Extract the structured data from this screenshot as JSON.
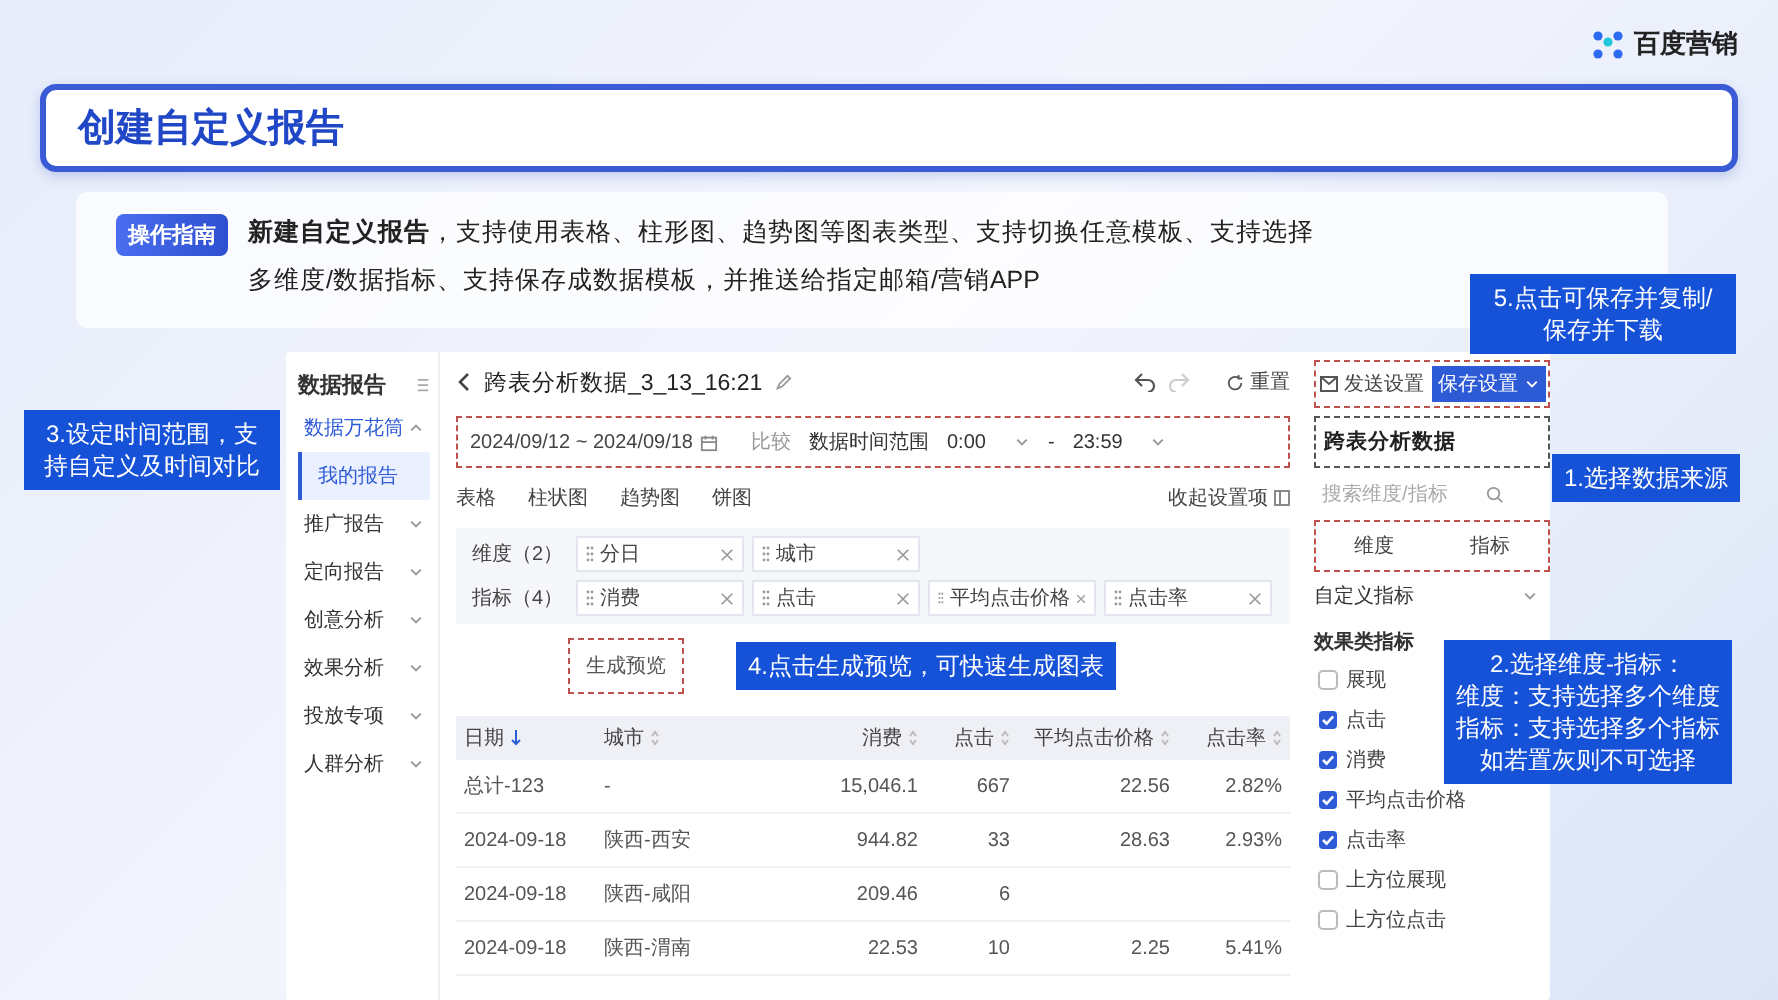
{
  "logo": {
    "text": "百度营销"
  },
  "title": "创建自定义报告",
  "guide": {
    "badge": "操作指南",
    "text": "**新建自定义报告**，支持使用表格、柱形图、趋势图等图表类型、支持切换任意模板、支持选择多维度/数据指标、支持保存成数据模板，并推送给指定邮箱/营销APP"
  },
  "sidebar": {
    "title": "数据报告",
    "items": [
      {
        "label": "数据万花筒",
        "expanded": true,
        "selected": false,
        "children": [
          {
            "label": "我的报告",
            "selected": true
          }
        ]
      },
      {
        "label": "推广报告",
        "expanded": false,
        "selected": false
      },
      {
        "label": "定向报告",
        "expanded": false,
        "selected": false
      },
      {
        "label": "创意分析",
        "expanded": false,
        "selected": false
      },
      {
        "label": "效果分析",
        "expanded": false,
        "selected": false
      },
      {
        "label": "投放专项",
        "expanded": false,
        "selected": false
      },
      {
        "label": "人群分析",
        "expanded": false,
        "selected": false
      }
    ]
  },
  "report": {
    "title": "跨表分析数据_3_13_16:21",
    "reset": "重置"
  },
  "date_filter": {
    "range": "2024/09/12 ~ 2024/09/18",
    "compare": "比较",
    "scope": "数据时间范围",
    "start": "0:00",
    "separator": "-",
    "end": "23:59"
  },
  "chart_types": [
    "表格",
    "柱状图",
    "趋势图",
    "饼图"
  ],
  "collapse": "收起设置项",
  "dimensions": {
    "label": "维度（2）",
    "chips": [
      "分日",
      "城市"
    ]
  },
  "metrics": {
    "label": "指标（4）",
    "chips": [
      "消费",
      "点击",
      "平均点击价格",
      "点击率"
    ]
  },
  "preview": {
    "button": "生成预览",
    "hint": "4.点击生成预览，可快速生成图表"
  },
  "table": {
    "columns": [
      {
        "label": "日期",
        "sorted": true
      },
      {
        "label": "城市",
        "sorted": false
      },
      {
        "label": "消费",
        "sorted": false
      },
      {
        "label": "点击",
        "sorted": false
      },
      {
        "label": "平均点击价格",
        "sorted": false
      },
      {
        "label": "点击率",
        "sorted": false
      }
    ],
    "rows": [
      [
        "总计-123",
        "-",
        "15,046.1",
        "667",
        "22.56",
        "2.82%"
      ],
      [
        "2024-09-18",
        "陕西-西安",
        "944.82",
        "33",
        "28.63",
        "2.93%"
      ],
      [
        "2024-09-18",
        "陕西-咸阳",
        "209.46",
        "6",
        null,
        null
      ],
      [
        "2024-09-18",
        "陕西-渭南",
        "22.53",
        "10",
        "2.25",
        "5.41%"
      ]
    ]
  },
  "panel": {
    "send": "发送设置",
    "save": "保存设置",
    "source": "跨表分析数据",
    "search": {
      "placeholder": "搜索维度/指标"
    },
    "tabs": [
      "维度",
      "指标"
    ],
    "custom_group": "自定义指标",
    "group": "效果类指标",
    "metrics": [
      {
        "label": "展现",
        "checked": false
      },
      {
        "label": "点击",
        "checked": true
      },
      {
        "label": "消费",
        "checked": true
      },
      {
        "label": "平均点击价格",
        "checked": true
      },
      {
        "label": "点击率",
        "checked": true
      },
      {
        "label": "上方位展现",
        "checked": false
      },
      {
        "label": "上方位点击",
        "checked": false
      }
    ]
  },
  "callouts": [
    {
      "lines": [
        "5.点击可保存并复制/",
        "保存并下载"
      ]
    },
    {
      "lines": [
        "3.设定时间范围，支",
        "持自定义及时间对比"
      ]
    },
    {
      "lines": [
        "1.选择数据来源"
      ]
    },
    {
      "lines": [
        "2.选择维度-指标：",
        "维度：支持选择多个维度",
        "指标：支持选择多个指标",
        "如若置灰则不可选择"
      ]
    }
  ]
}
